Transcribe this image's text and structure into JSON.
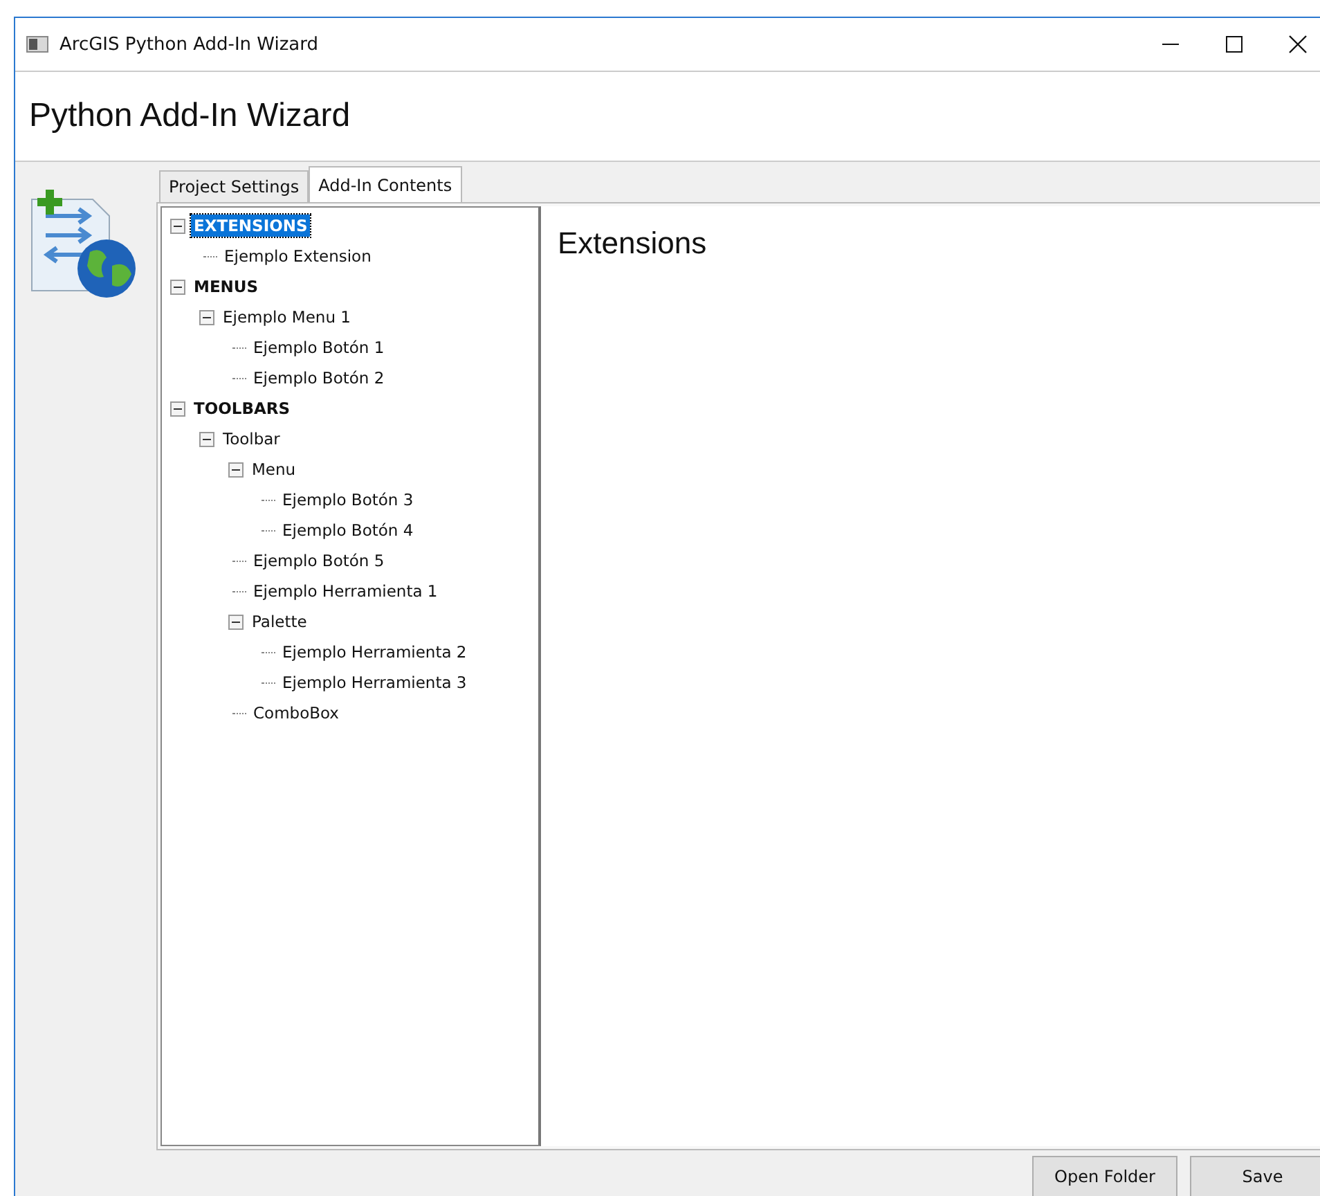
{
  "window": {
    "title": "ArcGIS Python Add-In Wizard"
  },
  "header": {
    "title": "Python Add-In Wizard"
  },
  "tabs": [
    {
      "label": "Project Settings",
      "selected": false
    },
    {
      "label": "Add-In Contents",
      "selected": true
    }
  ],
  "tree": [
    {
      "label": "EXTENSIONS",
      "kind": "category",
      "selected": true,
      "expanded": true,
      "children": [
        {
          "label": "Ejemplo Extension",
          "kind": "item",
          "selected": false
        }
      ]
    },
    {
      "label": "MENUS",
      "kind": "category",
      "selected": false,
      "expanded": true,
      "children": [
        {
          "label": "Ejemplo Menu 1",
          "kind": "item",
          "selected": false,
          "expanded": true,
          "children": [
            {
              "label": "Ejemplo Botón 1",
              "kind": "item",
              "selected": false
            },
            {
              "label": "Ejemplo Botón 2",
              "kind": "item",
              "selected": false
            }
          ]
        }
      ]
    },
    {
      "label": "TOOLBARS",
      "kind": "category",
      "selected": false,
      "expanded": true,
      "children": [
        {
          "label": "Toolbar",
          "kind": "item",
          "selected": false,
          "expanded": true,
          "children": [
            {
              "label": "Menu",
              "kind": "item",
              "selected": false,
              "expanded": true,
              "children": [
                {
                  "label": "Ejemplo Botón 3",
                  "kind": "item",
                  "selected": false
                },
                {
                  "label": "Ejemplo Botón 4",
                  "kind": "item",
                  "selected": false
                }
              ]
            },
            {
              "label": "Ejemplo Botón 5",
              "kind": "item",
              "selected": false
            },
            {
              "label": "Ejemplo Herramienta 1",
              "kind": "item",
              "selected": false
            },
            {
              "label": "Palette",
              "kind": "item",
              "selected": false,
              "expanded": true,
              "children": [
                {
                  "label": "Ejemplo Herramienta 2",
                  "kind": "item",
                  "selected": false
                },
                {
                  "label": "Ejemplo Herramienta 3",
                  "kind": "item",
                  "selected": false
                }
              ]
            },
            {
              "label": "ComboBox",
              "kind": "item",
              "selected": false
            }
          ]
        }
      ]
    }
  ],
  "detail": {
    "title": "Extensions"
  },
  "buttons": [
    "Open Folder",
    "Save"
  ]
}
